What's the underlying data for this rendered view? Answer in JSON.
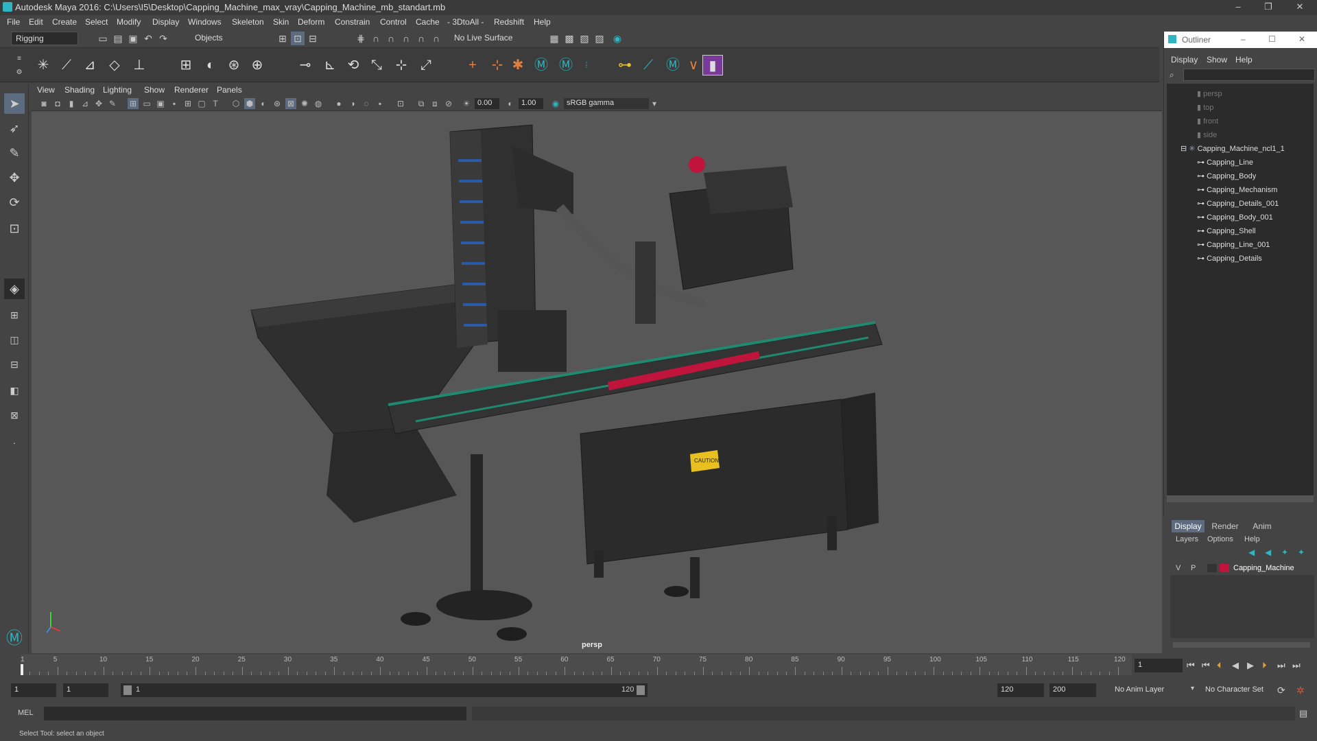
{
  "window": {
    "title": "Autodesk Maya 2016: C:\\Users\\I5\\Desktop\\Capping_Machine_max_vray\\Capping_Machine_mb_standart.mb",
    "minimize": "–",
    "maximize": "❐",
    "close": "✕"
  },
  "menubar": [
    "File",
    "Edit",
    "Create",
    "Select",
    "Modify",
    "Display",
    "Windows",
    "Skeleton",
    "Skin",
    "Deform",
    "Constrain",
    "Control",
    "Cache",
    "- 3DtoAll -",
    "Redshift",
    "Help"
  ],
  "toolbar": {
    "menu_set": "Rigging",
    "selection_mask": "Objects",
    "live_surface": "No Live Surface"
  },
  "viewport": {
    "menus": [
      "View",
      "Shading",
      "Lighting",
      "Show",
      "Renderer",
      "Panels"
    ],
    "exposure": "0.00",
    "gamma": "1.00",
    "color_space": "sRGB gamma",
    "camera_label": "persp",
    "caution_label": "CAUTION"
  },
  "outliner": {
    "title": "Outliner",
    "minimize": "–",
    "maximize": "☐",
    "close": "✕",
    "menus": [
      "Display",
      "Show",
      "Help"
    ],
    "cameras": [
      "persp",
      "top",
      "front",
      "side"
    ],
    "root": "Capping_Machine_ncl1_1",
    "children": [
      "Capping_Line",
      "Capping_Body",
      "Capping_Mechanism",
      "Capping_Details_001",
      "Capping_Body_001",
      "Capping_Shell",
      "Capping_Line_001",
      "Capping_Details"
    ]
  },
  "layers": {
    "tabs": [
      "Display",
      "Render",
      "Anim"
    ],
    "menus": [
      "Layers",
      "Options",
      "Help"
    ],
    "layer": {
      "v": "V",
      "p": "P",
      "name": "Capping_Machine",
      "color": "#c0143c"
    }
  },
  "timeline": {
    "ticks": [
      "5",
      "10",
      "15",
      "20",
      "25",
      "30",
      "35",
      "40",
      "45",
      "50",
      "55",
      "60",
      "65",
      "70",
      "75",
      "80",
      "85",
      "90",
      "95",
      "100",
      "105",
      "110",
      "115",
      "120"
    ],
    "start_tick": "1",
    "current_frame": "1"
  },
  "range": {
    "start": "1",
    "playback_start": "1",
    "slider_start": "1",
    "slider_end": "120",
    "playback_end": "120",
    "end": "200",
    "anim_layer": "No Anim Layer",
    "character_set": "No Character Set"
  },
  "cmdline": {
    "label": "MEL"
  },
  "status": {
    "text": "Select Tool: select an object"
  },
  "colors": {
    "accent": "#5d6b80",
    "maya_teal": "#2fb5c1",
    "belt_green": "#1f8a70",
    "belt_red": "#c0143c"
  }
}
